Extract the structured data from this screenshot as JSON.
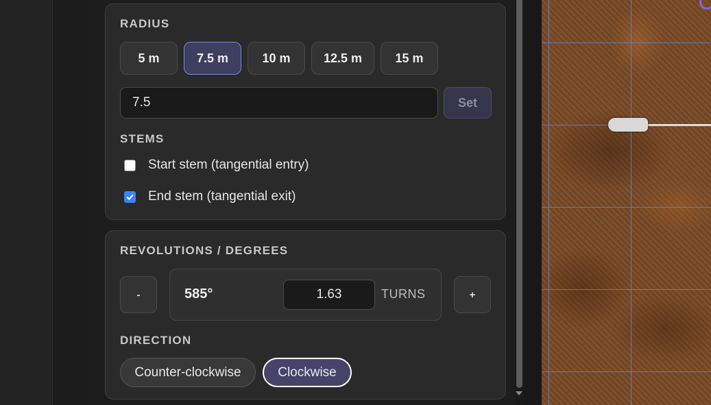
{
  "radius": {
    "label": "RADIUS",
    "presets": [
      "5 m",
      "7.5 m",
      "10 m",
      "12.5 m",
      "15 m"
    ],
    "selected": "7.5 m",
    "input_value": "7.5",
    "set_label": "Set"
  },
  "stems": {
    "label": "STEMS",
    "start": {
      "label": "Start stem (tangential entry)",
      "checked": false
    },
    "end": {
      "label": "End stem (tangential exit)",
      "checked": true
    }
  },
  "revolutions": {
    "label": "REVOLUTIONS / DEGREES",
    "minus_label": "-",
    "plus_label": "+",
    "degrees": "585°",
    "turns_value": "1.63",
    "turns_unit": "TURNS"
  },
  "direction": {
    "label": "DIRECTION",
    "options": [
      "Counter-clockwise",
      "Clockwise"
    ],
    "selected": "Clockwise"
  },
  "colors": {
    "accent": "#7f86d9",
    "checkbox": "#3b82f6",
    "selected_direction": "#48436a",
    "grid": "#5a8ce6",
    "marker": "#8a63d8"
  }
}
